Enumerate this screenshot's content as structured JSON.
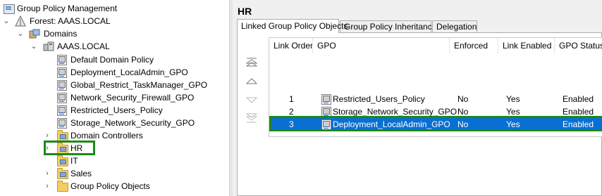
{
  "tree": {
    "root": "Group Policy Management",
    "forest": "Forest: AAAS.LOCAL",
    "domains": "Domains",
    "domain": "AAAS.LOCAL",
    "linked_gpos": [
      "Default Domain Policy",
      "Deployment_LocalAdmin_GPO",
      "Global_Restrict_TaskManager_GPO",
      "Network_Security_Firewall_GPO",
      "Restricted_Users_Policy",
      "Storage_Network_Security_GPO"
    ],
    "domain_controllers": "Domain Controllers",
    "ou_hr": "HR",
    "ou_it": "IT",
    "ou_sales": "Sales",
    "group_policy_objects": "Group Policy Objects"
  },
  "right": {
    "title": "HR",
    "tabs": [
      "Linked Group Policy Objects",
      "Group Policy Inheritance",
      "Delegation"
    ],
    "columns": [
      "Link Order",
      "GPO",
      "Enforced",
      "Link Enabled",
      "GPO Status"
    ],
    "rows": [
      {
        "order": "1",
        "gpo": "Restricted_Users_Policy",
        "enforced": "No",
        "enabled": "Yes",
        "status": "Enabled"
      },
      {
        "order": "2",
        "gpo": "Storage_Network_Security_GPO",
        "enforced": "No",
        "enabled": "Yes",
        "status": "Enabled"
      },
      {
        "order": "3",
        "gpo": "Deployment_LocalAdmin_GPO",
        "enforced": "No",
        "enabled": "Yes",
        "status": "Enabled"
      }
    ]
  },
  "colors": {
    "selection": "#0a6fd2",
    "highlight_outline": "#1a8a1a",
    "folder": "#f2cd62"
  }
}
